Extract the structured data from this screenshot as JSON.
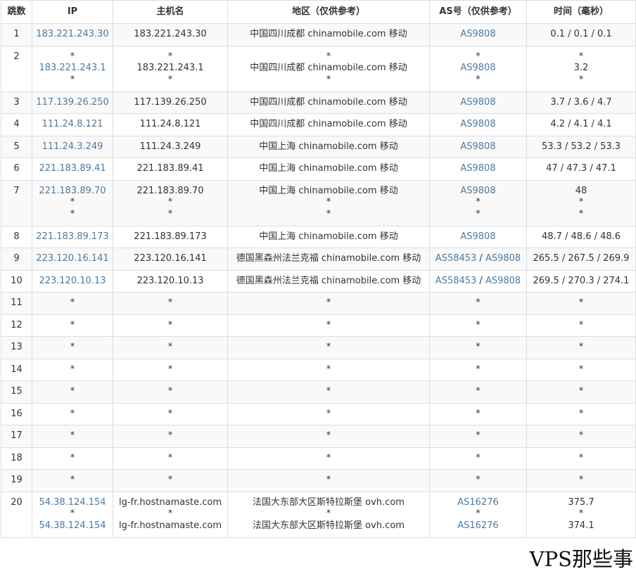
{
  "columns": [
    "跳数",
    "IP",
    "主机名",
    "地区（仅供参考）",
    "AS号（仅供参考）",
    "时间（毫秒）"
  ],
  "rows": [
    {
      "hop": "1",
      "ip": [
        "183.221.243.30"
      ],
      "host": [
        "183.221.243.30"
      ],
      "region": [
        "中国四川成都 chinamobile.com 移动"
      ],
      "as": [
        [
          "AS9808"
        ]
      ],
      "time": [
        "0.1 / 0.1 / 0.1"
      ]
    },
    {
      "hop": "2",
      "ip": [
        "*",
        "183.221.243.1",
        "*"
      ],
      "host": [
        "*",
        "183.221.243.1",
        "*"
      ],
      "region": [
        "*",
        "中国四川成都 chinamobile.com 移动",
        "*"
      ],
      "as": [
        [
          "*"
        ],
        [
          "AS9808"
        ],
        [
          "*"
        ]
      ],
      "time": [
        "*",
        "3.2",
        "*"
      ]
    },
    {
      "hop": "3",
      "ip": [
        "117.139.26.250"
      ],
      "host": [
        "117.139.26.250"
      ],
      "region": [
        "中国四川成都 chinamobile.com 移动"
      ],
      "as": [
        [
          "AS9808"
        ]
      ],
      "time": [
        "3.7 / 3.6 / 4.7"
      ]
    },
    {
      "hop": "4",
      "ip": [
        "111.24.8.121"
      ],
      "host": [
        "111.24.8.121"
      ],
      "region": [
        "中国四川成都 chinamobile.com 移动"
      ],
      "as": [
        [
          "AS9808"
        ]
      ],
      "time": [
        "4.2 / 4.1 / 4.1"
      ]
    },
    {
      "hop": "5",
      "ip": [
        "111.24.3.249"
      ],
      "host": [
        "111.24.3.249"
      ],
      "region": [
        "中国上海 chinamobile.com 移动"
      ],
      "as": [
        [
          "AS9808"
        ]
      ],
      "time": [
        "53.3 / 53.2 / 53.3"
      ]
    },
    {
      "hop": "6",
      "ip": [
        "221.183.89.41"
      ],
      "host": [
        "221.183.89.41"
      ],
      "region": [
        "中国上海 chinamobile.com 移动"
      ],
      "as": [
        [
          "AS9808"
        ]
      ],
      "time": [
        "47 / 47.3 / 47.1"
      ]
    },
    {
      "hop": "7",
      "ip": [
        "221.183.89.70",
        "*",
        "*"
      ],
      "host": [
        "221.183.89.70",
        "*",
        "*"
      ],
      "region": [
        "中国上海 chinamobile.com 移动",
        "*",
        "*"
      ],
      "as": [
        [
          "AS9808"
        ],
        [
          "*"
        ],
        [
          "*"
        ]
      ],
      "time": [
        "48",
        "*",
        "*"
      ]
    },
    {
      "hop": "8",
      "ip": [
        "221.183.89.173"
      ],
      "host": [
        "221.183.89.173"
      ],
      "region": [
        "中国上海 chinamobile.com 移动"
      ],
      "as": [
        [
          "AS9808"
        ]
      ],
      "time": [
        "48.7 / 48.6 / 48.6"
      ]
    },
    {
      "hop": "9",
      "ip": [
        "223.120.16.141"
      ],
      "host": [
        "223.120.16.141"
      ],
      "region": [
        "德国黑森州法兰克福 chinamobile.com 移动"
      ],
      "as": [
        [
          "AS58453",
          "AS9808"
        ]
      ],
      "time": [
        "265.5 / 267.5 / 269.9"
      ]
    },
    {
      "hop": "10",
      "ip": [
        "223.120.10.13"
      ],
      "host": [
        "223.120.10.13"
      ],
      "region": [
        "德国黑森州法兰克福 chinamobile.com 移动"
      ],
      "as": [
        [
          "AS58453",
          "AS9808"
        ]
      ],
      "time": [
        "269.5 / 270.3 / 274.1"
      ]
    },
    {
      "hop": "11",
      "ip": [
        "*"
      ],
      "host": [
        "*"
      ],
      "region": [
        "*"
      ],
      "as": [
        [
          "*"
        ]
      ],
      "time": [
        "*"
      ]
    },
    {
      "hop": "12",
      "ip": [
        "*"
      ],
      "host": [
        "*"
      ],
      "region": [
        "*"
      ],
      "as": [
        [
          "*"
        ]
      ],
      "time": [
        "*"
      ]
    },
    {
      "hop": "13",
      "ip": [
        "*"
      ],
      "host": [
        "*"
      ],
      "region": [
        "*"
      ],
      "as": [
        [
          "*"
        ]
      ],
      "time": [
        "*"
      ]
    },
    {
      "hop": "14",
      "ip": [
        "*"
      ],
      "host": [
        "*"
      ],
      "region": [
        "*"
      ],
      "as": [
        [
          "*"
        ]
      ],
      "time": [
        "*"
      ]
    },
    {
      "hop": "15",
      "ip": [
        "*"
      ],
      "host": [
        "*"
      ],
      "region": [
        "*"
      ],
      "as": [
        [
          "*"
        ]
      ],
      "time": [
        "*"
      ]
    },
    {
      "hop": "16",
      "ip": [
        "*"
      ],
      "host": [
        "*"
      ],
      "region": [
        "*"
      ],
      "as": [
        [
          "*"
        ]
      ],
      "time": [
        "*"
      ]
    },
    {
      "hop": "17",
      "ip": [
        "*"
      ],
      "host": [
        "*"
      ],
      "region": [
        "*"
      ],
      "as": [
        [
          "*"
        ]
      ],
      "time": [
        "*"
      ]
    },
    {
      "hop": "18",
      "ip": [
        "*"
      ],
      "host": [
        "*"
      ],
      "region": [
        "*"
      ],
      "as": [
        [
          "*"
        ]
      ],
      "time": [
        "*"
      ]
    },
    {
      "hop": "19",
      "ip": [
        "*"
      ],
      "host": [
        "*"
      ],
      "region": [
        "*"
      ],
      "as": [
        [
          "*"
        ]
      ],
      "time": [
        "*"
      ]
    },
    {
      "hop": "20",
      "ip": [
        "54.38.124.154",
        "*",
        "54.38.124.154"
      ],
      "host": [
        "lg-fr.hostnamaste.com",
        "*",
        "lg-fr.hostnamaste.com"
      ],
      "region": [
        "法国大东部大区斯特拉斯堡 ovh.com",
        "*",
        "法国大东部大区斯特拉斯堡 ovh.com"
      ],
      "as": [
        [
          "AS16276"
        ],
        [
          "*"
        ],
        [
          "AS16276"
        ]
      ],
      "time": [
        "375.7",
        "*",
        "374.1"
      ]
    }
  ],
  "watermark": "VPS那些事"
}
